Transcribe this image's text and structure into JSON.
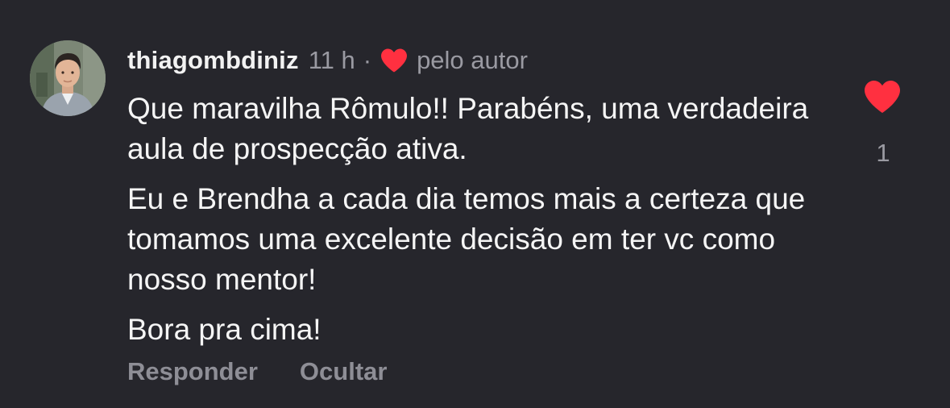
{
  "comment": {
    "username": "thiagombdiniz",
    "time": "11 h",
    "separator": "·",
    "liked_by_author_label": "pelo autor",
    "paragraphs": [
      "Que maravilha Rômulo!! Parabéns, uma verdadeira aula de prospecção ativa.",
      "Eu e Brendha a cada dia temos mais a certeza que tomamos uma excelente decisão em ter vc como nosso mentor!",
      "Bora pra cima!"
    ],
    "like_count": "1"
  },
  "actions": {
    "reply_label": "Responder",
    "hide_label": "Ocultar"
  },
  "colors": {
    "background": "#26262c",
    "heart": "#ff3040",
    "muted_text": "#9a9aa2"
  },
  "icons": {
    "author_heart": "heart-filled-icon",
    "like_heart": "heart-filled-icon"
  }
}
